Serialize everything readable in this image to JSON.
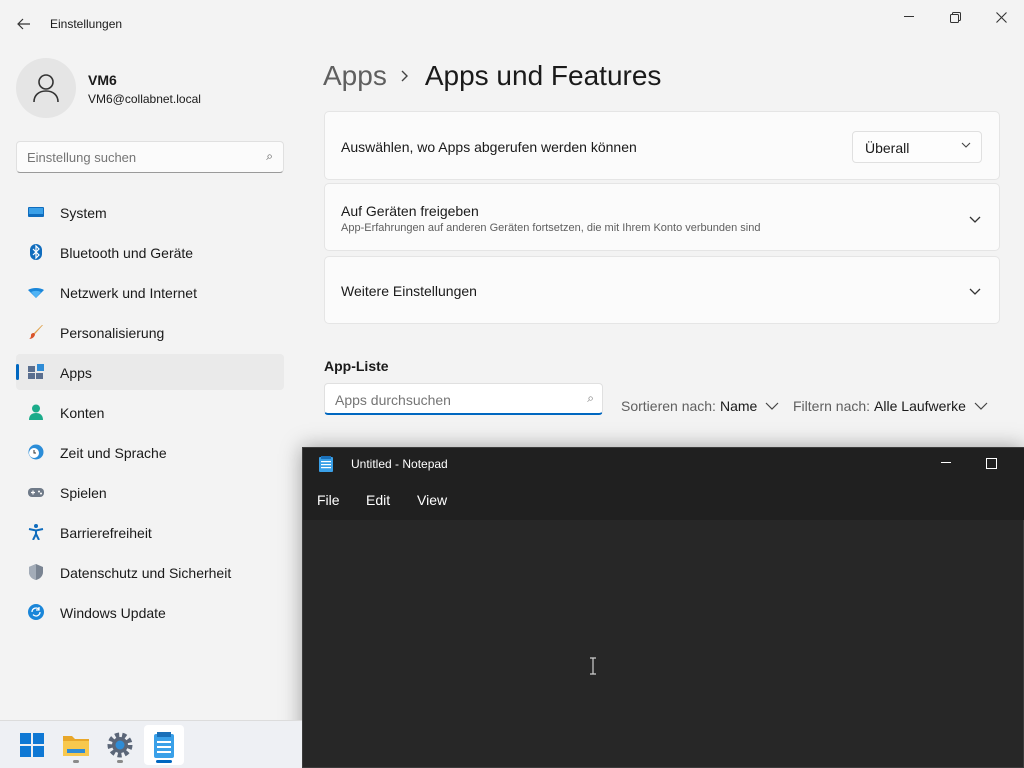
{
  "settings": {
    "window_title": "Einstellungen",
    "user": {
      "name": "VM6",
      "email": "VM6@collabnet.local"
    },
    "search_placeholder": "Einstellung suchen",
    "nav": [
      {
        "label": "System",
        "icon": "monitor-icon"
      },
      {
        "label": "Bluetooth und Geräte",
        "icon": "bluetooth-icon"
      },
      {
        "label": "Netzwerk und Internet",
        "icon": "wifi-icon"
      },
      {
        "label": "Personalisierung",
        "icon": "paintbrush-icon"
      },
      {
        "label": "Apps",
        "icon": "apps-icon",
        "active": true
      },
      {
        "label": "Konten",
        "icon": "person-icon"
      },
      {
        "label": "Zeit und Sprache",
        "icon": "clock-globe-icon"
      },
      {
        "label": "Spielen",
        "icon": "gamepad-icon"
      },
      {
        "label": "Barrierefreiheit",
        "icon": "accessibility-icon"
      },
      {
        "label": "Datenschutz und Sicherheit",
        "icon": "shield-icon"
      },
      {
        "label": "Windows Update",
        "icon": "update-icon"
      }
    ],
    "breadcrumb": {
      "parent": "Apps",
      "current": "Apps und Features"
    },
    "cards": {
      "source": {
        "title": "Auswählen, wo Apps abgerufen werden können",
        "value": "Überall"
      },
      "share": {
        "title": "Auf Geräten freigeben",
        "subtitle": "App-Erfahrungen auf anderen Geräten fortsetzen, die mit Ihrem Konto verbunden sind"
      },
      "more": {
        "title": "Weitere Einstellungen"
      }
    },
    "app_list": {
      "title": "App-Liste",
      "search_placeholder": "Apps durchsuchen",
      "sort_label": "Sortieren nach:",
      "sort_value": "Name",
      "filter_label": "Filtern nach:",
      "filter_value": "Alle Laufwerke"
    },
    "accent_color": "#0067c0"
  },
  "notepad": {
    "title": "Untitled - Notepad",
    "menu": [
      "File",
      "Edit",
      "View"
    ],
    "content": ""
  },
  "taskbar": {
    "items": [
      {
        "name": "start-button",
        "icon": "windows-logo-icon"
      },
      {
        "name": "file-explorer-button",
        "icon": "folder-icon"
      },
      {
        "name": "settings-button",
        "icon": "gear-icon"
      },
      {
        "name": "notepad-button",
        "icon": "notepad-icon",
        "active": true
      }
    ]
  }
}
